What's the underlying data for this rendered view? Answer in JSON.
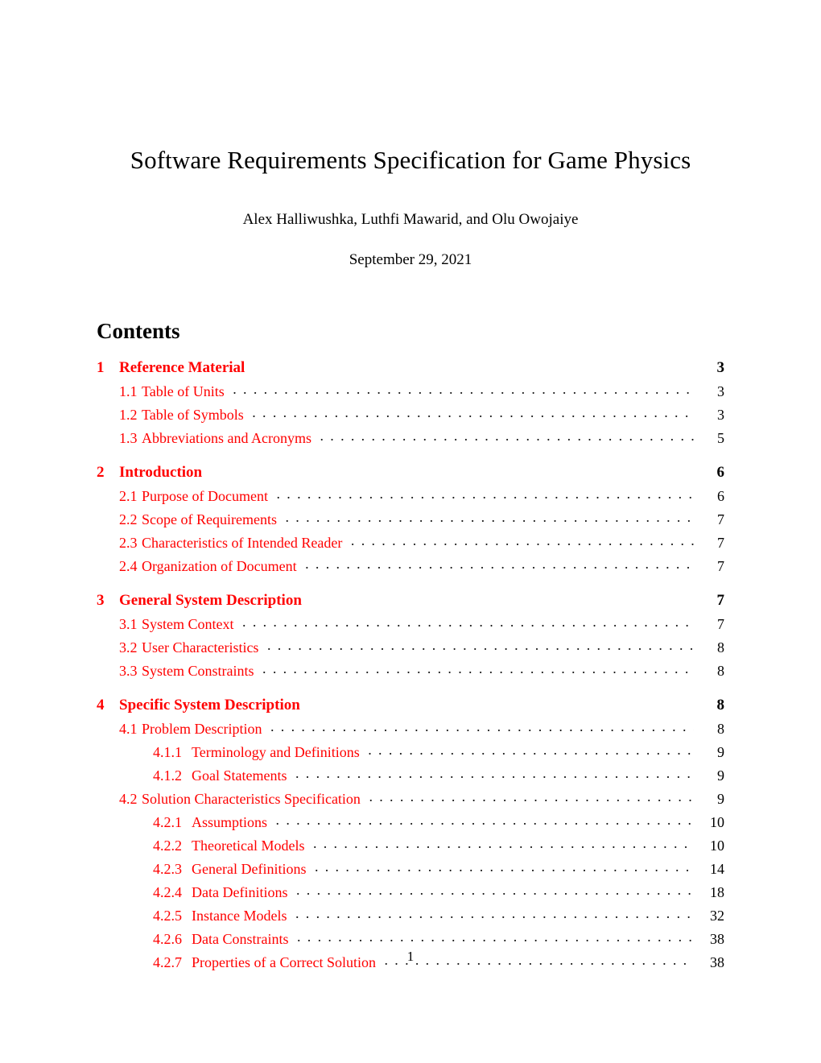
{
  "document": {
    "title": "Software Requirements Specification for Game Physics",
    "authors": "Alex Halliwushka, Luthfi Mawarid, and Olu Owojaiye",
    "date": "September 29, 2021",
    "page_number": "1"
  },
  "contents": {
    "heading": "Contents",
    "link_color": "#ff0000",
    "text_color": "#000000",
    "entries": [
      {
        "level": 1,
        "number": "1",
        "title": "Reference Material",
        "page": "3"
      },
      {
        "level": 2,
        "number": "1.1",
        "title": "Table of Units",
        "page": "3"
      },
      {
        "level": 2,
        "number": "1.2",
        "title": "Table of Symbols",
        "page": "3"
      },
      {
        "level": 2,
        "number": "1.3",
        "title": "Abbreviations and Acronyms",
        "page": "5"
      },
      {
        "level": 1,
        "number": "2",
        "title": "Introduction",
        "page": "6"
      },
      {
        "level": 2,
        "number": "2.1",
        "title": "Purpose of Document",
        "page": "6"
      },
      {
        "level": 2,
        "number": "2.2",
        "title": "Scope of Requirements",
        "page": "7"
      },
      {
        "level": 2,
        "number": "2.3",
        "title": "Characteristics of Intended Reader",
        "page": "7"
      },
      {
        "level": 2,
        "number": "2.4",
        "title": "Organization of Document",
        "page": "7"
      },
      {
        "level": 1,
        "number": "3",
        "title": "General System Description",
        "page": "7"
      },
      {
        "level": 2,
        "number": "3.1",
        "title": "System Context",
        "page": "7"
      },
      {
        "level": 2,
        "number": "3.2",
        "title": "User Characteristics",
        "page": "8"
      },
      {
        "level": 2,
        "number": "3.3",
        "title": "System Constraints",
        "page": "8"
      },
      {
        "level": 1,
        "number": "4",
        "title": "Specific System Description",
        "page": "8"
      },
      {
        "level": 2,
        "number": "4.1",
        "title": "Problem Description",
        "page": "8"
      },
      {
        "level": 3,
        "number": "4.1.1",
        "title": "Terminology and Definitions",
        "page": "9"
      },
      {
        "level": 3,
        "number": "4.1.2",
        "title": "Goal Statements",
        "page": "9"
      },
      {
        "level": 2,
        "number": "4.2",
        "title": "Solution Characteristics Specification",
        "page": "9"
      },
      {
        "level": 3,
        "number": "4.2.1",
        "title": "Assumptions",
        "page": "10"
      },
      {
        "level": 3,
        "number": "4.2.2",
        "title": "Theoretical Models",
        "page": "10"
      },
      {
        "level": 3,
        "number": "4.2.3",
        "title": "General Definitions",
        "page": "14"
      },
      {
        "level": 3,
        "number": "4.2.4",
        "title": "Data Definitions",
        "page": "18"
      },
      {
        "level": 3,
        "number": "4.2.5",
        "title": "Instance Models",
        "page": "32"
      },
      {
        "level": 3,
        "number": "4.2.6",
        "title": "Data Constraints",
        "page": "38"
      },
      {
        "level": 3,
        "number": "4.2.7",
        "title": "Properties of a Correct Solution",
        "page": "38"
      }
    ]
  }
}
